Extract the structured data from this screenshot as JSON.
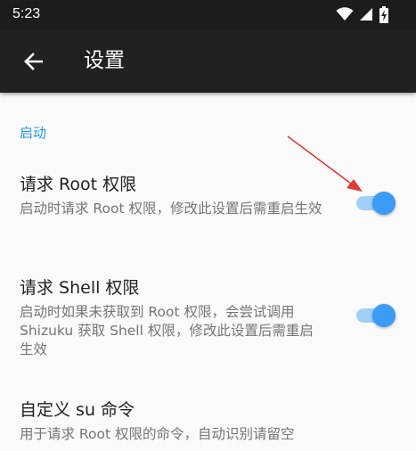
{
  "status_bar": {
    "time": "5:23"
  },
  "app_bar": {
    "title": "设置"
  },
  "section": {
    "header": "启动"
  },
  "preferences": [
    {
      "title": "请求 Root 权限",
      "summary": "启动时请求 Root 权限，修改此设置后需重启生效",
      "checked": true
    },
    {
      "title": "请求 Shell 权限",
      "summary": "启动时如果未获取到 Root 权限，会尝试调用 Shizuku 获取 Shell 权限，修改此设置后需重启生效",
      "checked": true
    },
    {
      "title": "自定义 su 命令",
      "summary": "用于请求 Root 权限的命令，自动识别请留空"
    }
  ],
  "colors": {
    "accent": "#2196f3",
    "switch_thumb": "#3a9cf4",
    "switch_track": "#9fd0f7",
    "app_bar": "#212121",
    "status_bar": "#1c1c1c",
    "annotation_arrow": "#e53935"
  },
  "icons": {
    "back": "arrow-left-icon",
    "wifi": "wifi-icon",
    "signal": "signal-icon",
    "battery": "battery-charging-icon"
  }
}
